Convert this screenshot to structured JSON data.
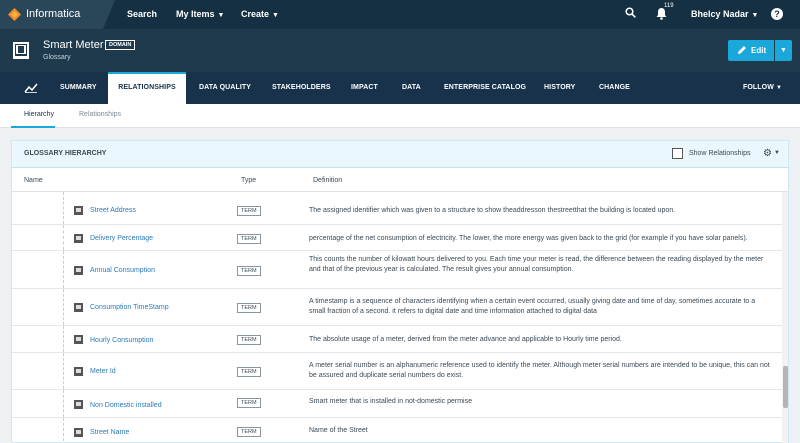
{
  "topbar": {
    "brand": "Informatica",
    "nav": [
      {
        "label": "Search",
        "chevron": false
      },
      {
        "label": "My Items",
        "chevron": true
      },
      {
        "label": "Create",
        "chevron": true
      }
    ],
    "notification_count": "119",
    "user_name": "Bhelcy Nadar",
    "help_label": "?"
  },
  "asset": {
    "title": "Smart Meter",
    "badge": "DOMAIN",
    "subtitle": "Glossary",
    "edit_label": "Edit"
  },
  "tabs": [
    "SUMMARY",
    "RELATIONSHIPS",
    "DATA QUALITY",
    "STAKEHOLDERS",
    "IMPACT",
    "DATA",
    "ENTERPRISE CATALOG",
    "HISTORY",
    "CHANGE"
  ],
  "active_tab": "RELATIONSHIPS",
  "follow_label": "FOLLOW",
  "subtabs": [
    "Hierarchy",
    "Relationships"
  ],
  "panel": {
    "title": "GLOSSARY HIERARCHY",
    "show_relationships": "Show Relationships",
    "columns": [
      "Name",
      "Type",
      "Definition"
    ]
  },
  "rows": [
    {
      "name": "Street Address",
      "type": "TERM",
      "definition": "The assigned identifier which was given to a structure to show theaddresson thestreetthat the building is located upon."
    },
    {
      "name": "Delivery Percentage",
      "type": "TERM",
      "definition": "percentage of the net consumption of electricity. The lower, the more energy was given back to the grid (for example if you have solar panels)."
    },
    {
      "name": "Annual Consumption",
      "type": "TERM",
      "definition": "This counts the number of kilowatt hours delivered to you. Each time your meter is read, the difference between the reading displayed by the meter and that of the previous year is calculated. The result gives your annual consumption."
    },
    {
      "name": "Consumption TimeStamp",
      "type": "TERM",
      "definition": "A timestamp is a sequence of characters identifying when a certain event occurred, usually giving date and time of day, sometimes accurate to a small fraction of a second. it refers to digital date and time information attached to digital data"
    },
    {
      "name": "Hourly Consumption",
      "type": "TERM",
      "definition": "The absolute usage of a meter, derived from the meter advance and applicable to Hourly time period."
    },
    {
      "name": "Meter Id",
      "type": "TERM",
      "definition": "A meter serial number is an alphanumeric reference used to identify the meter. Although meter serial numbers are intended to be unique, this can not be assured and duplicate serial numbers do exist."
    },
    {
      "name": "Non Domestic installed",
      "type": "TERM",
      "definition": "Smart meter that is installed in not-domestic permise"
    },
    {
      "name": "Street Name",
      "type": "TERM",
      "definition": "Name of the Street"
    }
  ],
  "colors": {
    "topbar": "#153042",
    "accent": "#1aa7d9",
    "link": "#2b7bb9"
  }
}
